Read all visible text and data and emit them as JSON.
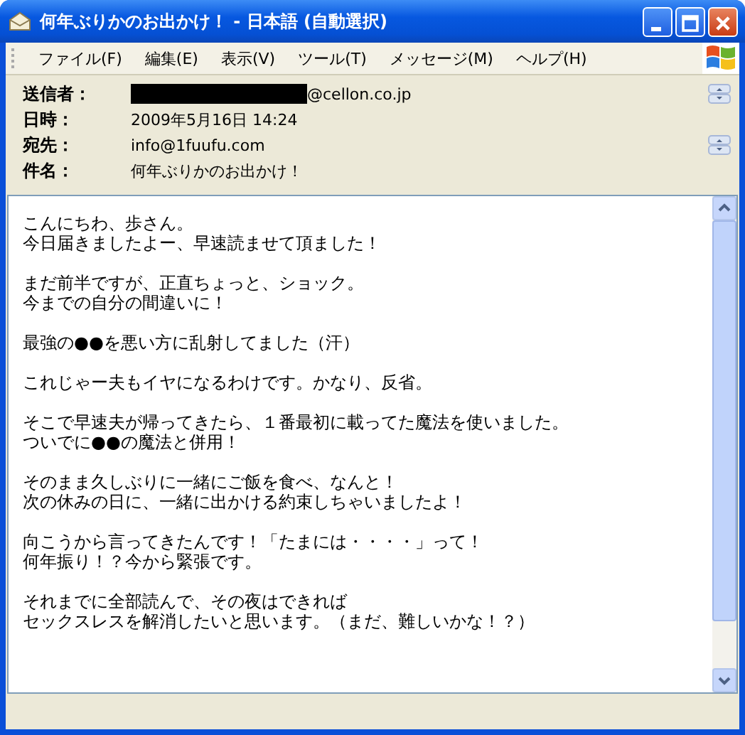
{
  "window": {
    "title": "何年ぶりかのお出かけ！ - 日本語 (自動選択)"
  },
  "menu": [
    "ファイル(F)",
    "編集(E)",
    "表示(V)",
    "ツール(T)",
    "メッセージ(M)",
    "ヘルプ(H)"
  ],
  "headers": [
    {
      "label": "送信者：",
      "value": "@cellon.co.jp",
      "redacted": true,
      "spinner": true
    },
    {
      "label": "日時：",
      "value": "2009年5月16日 14:24",
      "redacted": false,
      "spinner": false
    },
    {
      "label": "宛先：",
      "value": "info@1fuufu.com",
      "redacted": false,
      "spinner": true
    },
    {
      "label": "件名：",
      "value": "何年ぶりかのお出かけ！",
      "redacted": false,
      "spinner": false
    }
  ],
  "body": [
    {
      "lines": [
        "こんにちわ、歩さん。",
        "今日届きましたよー、早速読ませて頂ました！"
      ]
    },
    {
      "lines": [
        "まだ前半ですが、正直ちょっと、ショック。",
        "今までの自分の間違いに！"
      ]
    },
    {
      "lines": [
        "最強の●●を悪い方に乱射してました（汗）"
      ]
    },
    {
      "lines": [
        "これじゃー夫もイヤになるわけです。かなり、反省。"
      ]
    },
    {
      "lines": [
        "そこで早速夫が帰ってきたら、１番最初に載ってた魔法を使いました。",
        "ついでに●●の魔法と併用！"
      ]
    },
    {
      "lines": [
        "そのまま久しぶりに一緒にご飯を食べ、なんと！",
        "次の休みの日に、一緒に出かける約束しちゃいましたよ！"
      ]
    },
    {
      "lines": [
        "向こうから言ってきたんです！「たまには・・・・」って！",
        "何年振り！？今から緊張です。"
      ]
    },
    {
      "lines": [
        "それまでに全部読んで、その夜はできれば",
        "セックスレスを解消したいと思います。（まだ、難しいかな！？）"
      ]
    }
  ]
}
